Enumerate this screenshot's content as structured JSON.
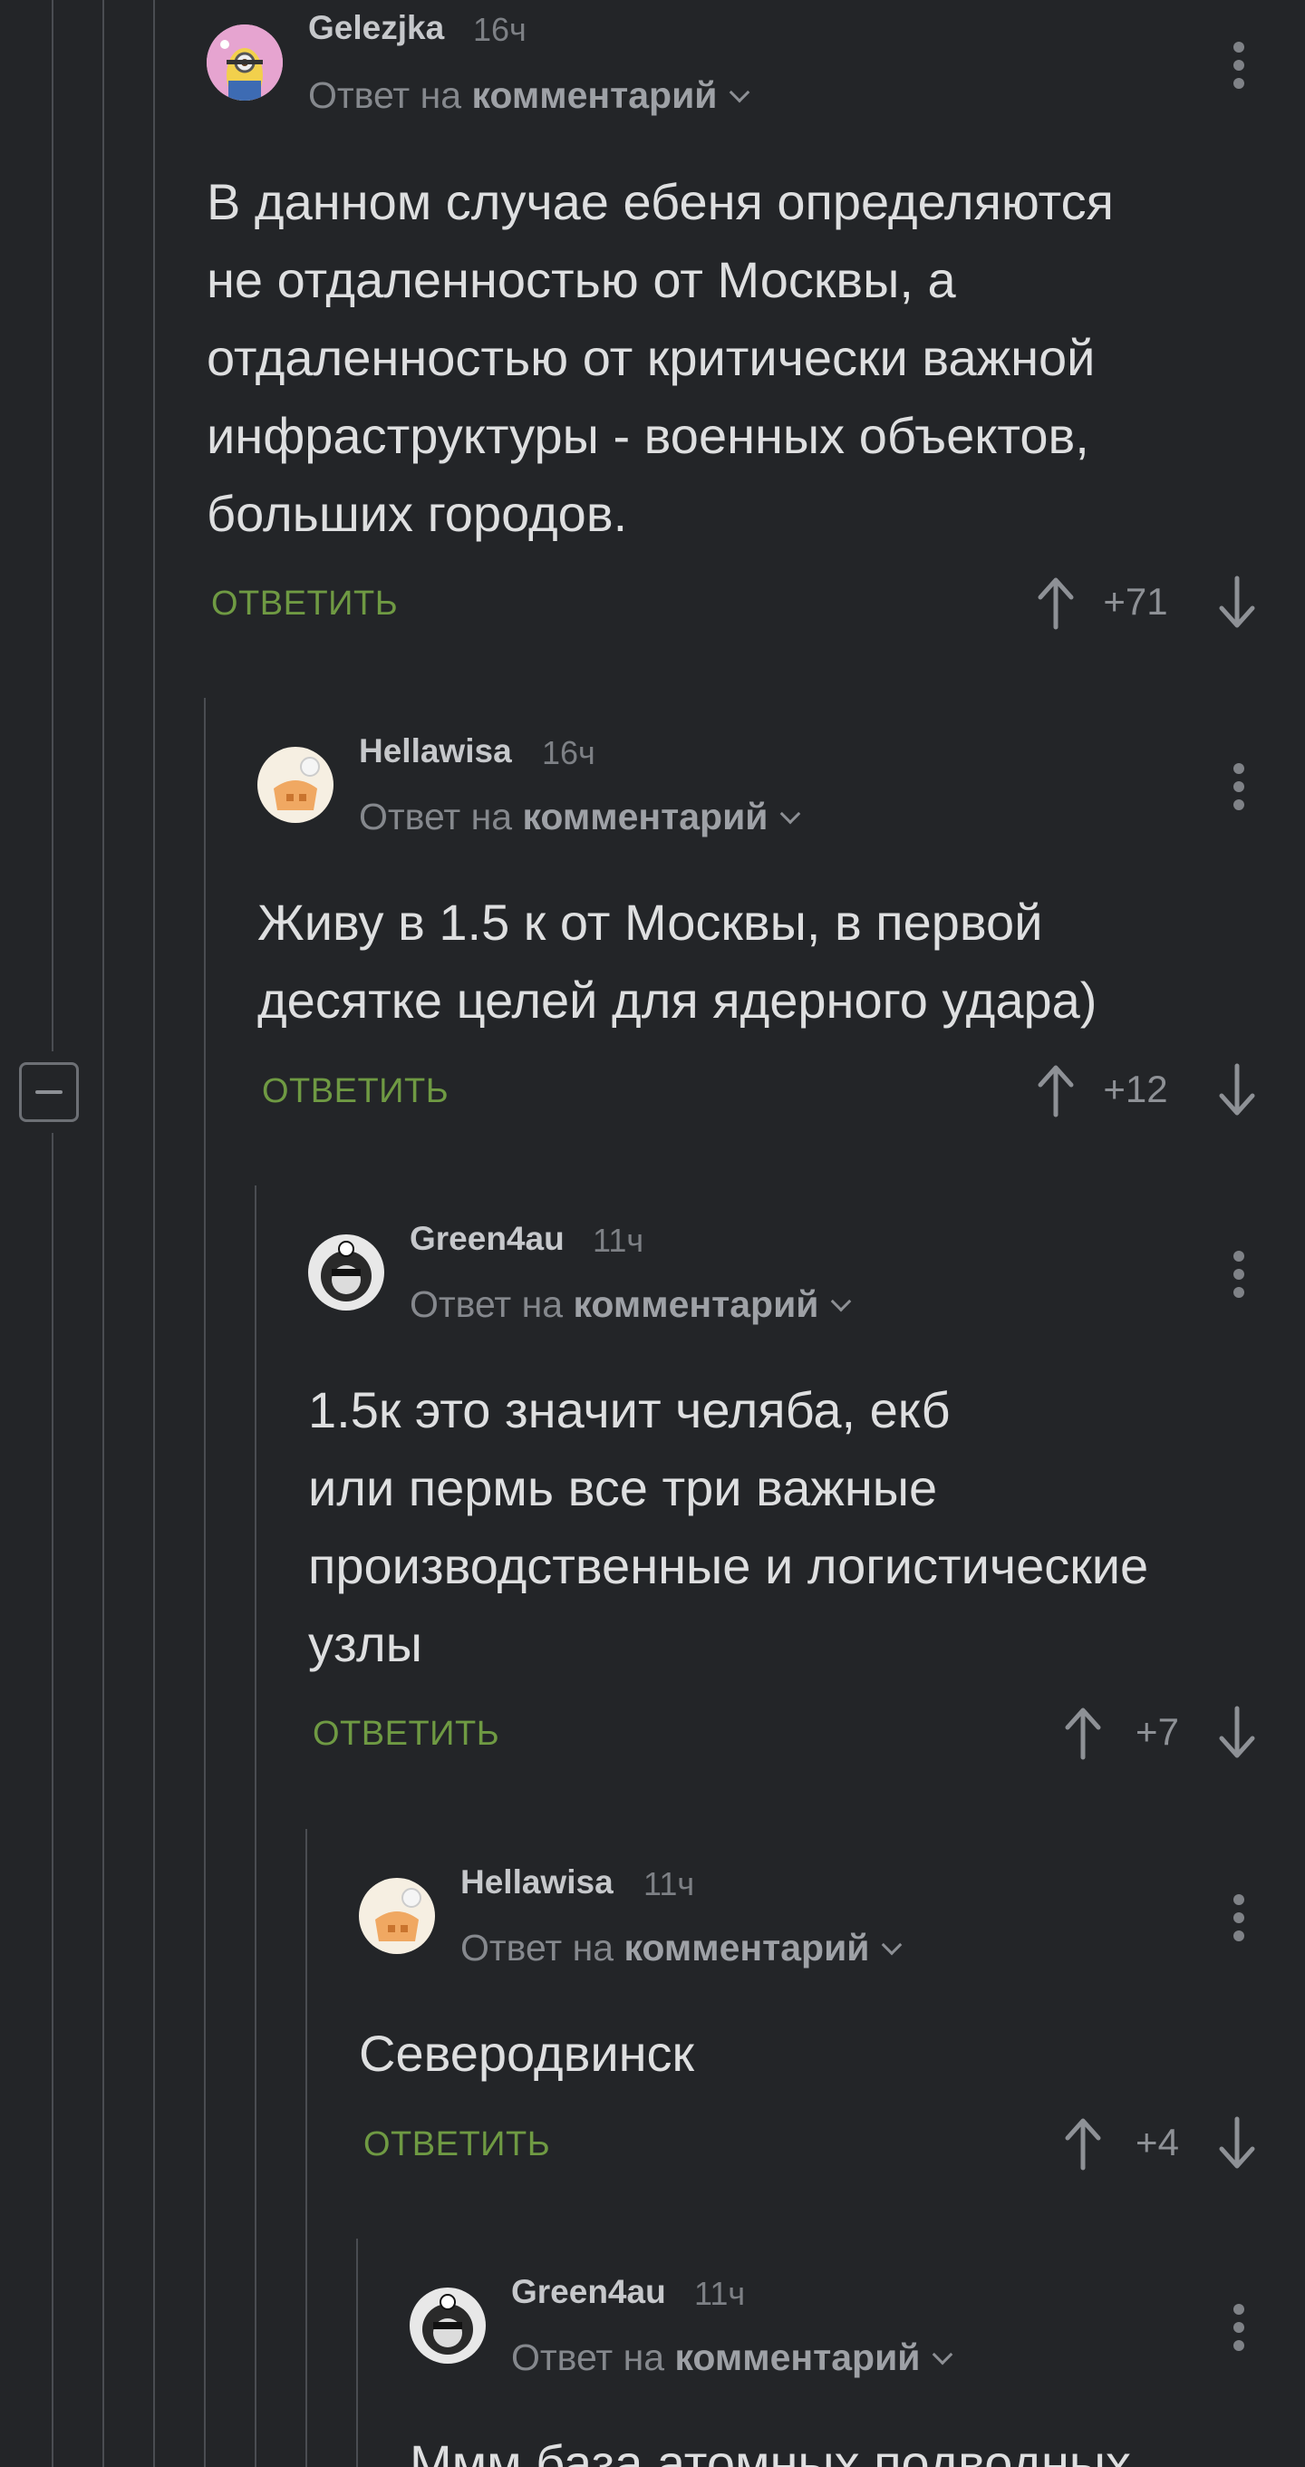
{
  "comments": [
    {
      "author": "Gelezjka",
      "time": "16ч",
      "reply_prefix": "Ответ на",
      "reply_target": "комментарий",
      "body_lines": [
        "В данном случае ебеня определяются",
        "не отдаленностью от Москвы, а",
        "отдаленностью от критически важной",
        "инфраструктуры - военных объектов,",
        "больших городов."
      ],
      "reply_label": "ОТВЕТИТЬ",
      "score": "+71"
    },
    {
      "author": "Hellawisa",
      "time": "16ч",
      "reply_prefix": "Ответ на",
      "reply_target": "комментарий",
      "body_lines": [
        "Живу в 1.5 к от Москвы, в первой",
        "десятке целей для ядерного удара)"
      ],
      "reply_label": "ОТВЕТИТЬ",
      "score": "+12"
    },
    {
      "author": "Green4au",
      "time": "11ч",
      "reply_prefix": "Ответ на",
      "reply_target": "комментарий",
      "body_lines": [
        "1.5к это значит челяба, екб",
        "или пермь все три важные",
        "производственные и логистические",
        "узлы"
      ],
      "reply_label": "ОТВЕТИТЬ",
      "score": "+7"
    },
    {
      "author": "Hellawisa",
      "time": "11ч",
      "reply_prefix": "Ответ на",
      "reply_target": "комментарий",
      "body_lines": [
        "Северодвинск"
      ],
      "reply_label": "ОТВЕТИТЬ",
      "score": "+4"
    },
    {
      "author": "Green4au",
      "time": "11ч",
      "reply_prefix": "Ответ на",
      "reply_target": "комментарий",
      "body_lines": [
        "Ммм база атомных подводных"
      ]
    }
  ],
  "colors": {
    "background": "#232528",
    "reply_accent": "#6f9a43",
    "thread_line": "#4a4d52"
  },
  "icons": {
    "vote_up": "arrow-up-icon",
    "vote_down": "arrow-down-icon",
    "more": "more-vertical-icon",
    "collapse": "collapse-minus-icon",
    "expand_reply": "chevron-down-icon"
  }
}
